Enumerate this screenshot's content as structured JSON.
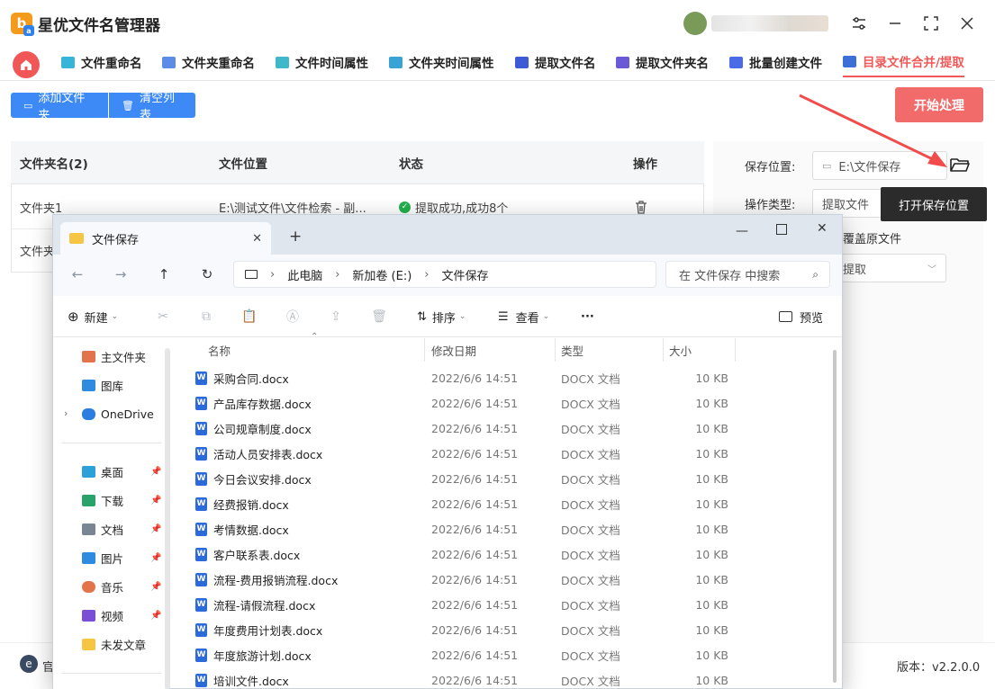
{
  "app": {
    "title": "星优文件名管理器",
    "logo_letters": "b",
    "logo_sub": "a"
  },
  "window_controls": {
    "settings": "⚙",
    "minimize": "—",
    "maximize": "⛶",
    "close": "✕"
  },
  "tabs": [
    {
      "label": "文件重命名",
      "color": "#36b5d8"
    },
    {
      "label": "文件夹重命名",
      "color": "#5b8de6"
    },
    {
      "label": "文件时间属性",
      "color": "#3fb8c9"
    },
    {
      "label": "文件夹时间属性",
      "color": "#3aa3d6"
    },
    {
      "label": "提取文件名",
      "color": "#3d5bd6"
    },
    {
      "label": "提取文件夹名",
      "color": "#6a5ad6"
    },
    {
      "label": "批量创建文件",
      "color": "#4a6ae6"
    },
    {
      "label": "目录文件合并/提取",
      "color": "#3d6fd9"
    }
  ],
  "toolbar": {
    "add_folder": "添加文件夹",
    "clear_list": "清空列表",
    "start": "开始处理"
  },
  "list": {
    "headers": {
      "name": "文件夹名(2)",
      "location": "文件位置",
      "status": "状态",
      "action": "操作"
    },
    "rows": [
      {
        "name": "文件夹1",
        "location": "E:\\测试文件\\文件检索 - 副...",
        "status": "提取成功,成功8个"
      },
      {
        "name": "文件夹",
        "location": "",
        "status": ""
      }
    ]
  },
  "settings": {
    "save_label": "保存位置:",
    "save_value": "E:\\文件保存",
    "type_label": "操作类型:",
    "type_value": "提取文件",
    "overwrite_text": "覆盖原文件",
    "mode_value": "提取",
    "tooltip": "打开保存位置"
  },
  "footer": {
    "left_text": "官",
    "version": "版本：v2.2.0.0"
  },
  "explorer": {
    "tab_title": "文件保存",
    "breadcrumbs": [
      "此电脑",
      "新加卷 (E:)",
      "文件保存"
    ],
    "search_placeholder": "在 文件保存 中搜索",
    "commands": {
      "new": "新建",
      "sort": "排序",
      "view": "查看",
      "more": "···",
      "preview": "预览"
    },
    "nav": [
      {
        "label": "主文件夹",
        "color": "#e2734b"
      },
      {
        "label": "图库",
        "color": "#2f8be0"
      },
      {
        "label": "OneDrive",
        "color": "#2b7de0"
      },
      {
        "label": "桌面",
        "color": "#2ea0d8"
      },
      {
        "label": "下载",
        "color": "#2aa36b"
      },
      {
        "label": "文档",
        "color": "#7a8594"
      },
      {
        "label": "图片",
        "color": "#2f8be0"
      },
      {
        "label": "音乐",
        "color": "#e2734b"
      },
      {
        "label": "视频",
        "color": "#7a4fd6"
      },
      {
        "label": "未发文章",
        "color": "#f6c544"
      }
    ],
    "columns": {
      "name": "名称",
      "date": "修改日期",
      "type": "类型",
      "size": "大小"
    },
    "files": [
      {
        "name": "采购合同.docx",
        "date": "2022/6/6 14:51",
        "type": "DOCX 文档",
        "size": "10 KB"
      },
      {
        "name": "产品库存数据.docx",
        "date": "2022/6/6 14:51",
        "type": "DOCX 文档",
        "size": "10 KB"
      },
      {
        "name": "公司规章制度.docx",
        "date": "2022/6/6 14:51",
        "type": "DOCX 文档",
        "size": "10 KB"
      },
      {
        "name": "活动人员安排表.docx",
        "date": "2022/6/6 14:51",
        "type": "DOCX 文档",
        "size": "10 KB"
      },
      {
        "name": "今日会议安排.docx",
        "date": "2022/6/6 14:51",
        "type": "DOCX 文档",
        "size": "10 KB"
      },
      {
        "name": "经费报销.docx",
        "date": "2022/6/6 14:51",
        "type": "DOCX 文档",
        "size": "10 KB"
      },
      {
        "name": "考情数据.docx",
        "date": "2022/6/6 14:51",
        "type": "DOCX 文档",
        "size": "10 KB"
      },
      {
        "name": "客户联系表.docx",
        "date": "2022/6/6 14:51",
        "type": "DOCX 文档",
        "size": "10 KB"
      },
      {
        "name": "流程-费用报销流程.docx",
        "date": "2022/6/6 14:51",
        "type": "DOCX 文档",
        "size": "10 KB"
      },
      {
        "name": "流程-请假流程.docx",
        "date": "2022/6/6 14:51",
        "type": "DOCX 文档",
        "size": "10 KB"
      },
      {
        "name": "年度费用计划表.docx",
        "date": "2022/6/6 14:51",
        "type": "DOCX 文档",
        "size": "10 KB"
      },
      {
        "name": "年度旅游计划.docx",
        "date": "2022/6/6 14:51",
        "type": "DOCX 文档",
        "size": "10 KB"
      },
      {
        "name": "培训文件.docx",
        "date": "2022/6/6 14:51",
        "type": "DOCX 文档",
        "size": "10 KB"
      }
    ]
  },
  "colors": {
    "accent": "#f25757",
    "primary": "#3d8af7",
    "start": "#f26b6b",
    "success": "#23b14d"
  }
}
